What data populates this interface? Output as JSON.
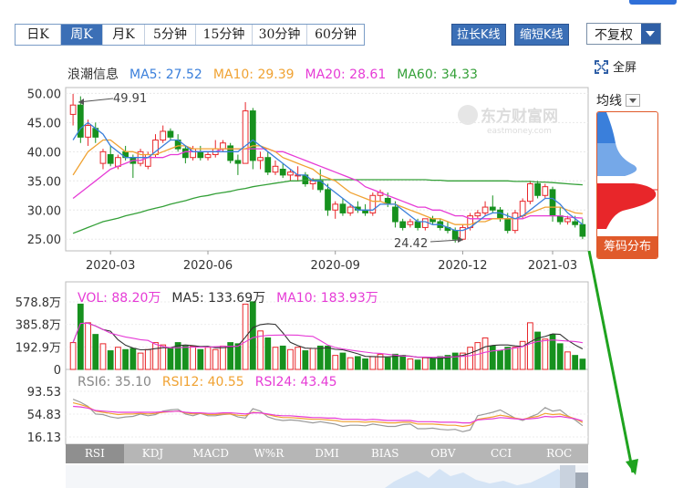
{
  "period_tabs": [
    "日K",
    "周K",
    "月K",
    "5分钟",
    "15分钟",
    "30分钟",
    "60分钟"
  ],
  "active_period": "周K",
  "zoom": {
    "stretch_label": "拉长K线",
    "shrink_label": "缩短K线"
  },
  "adjust": {
    "selected": "不复权"
  },
  "fullscreen_label": "全屏",
  "main_legend": {
    "stock_name": "浪潮信息",
    "ma5": "MA5: 27.52",
    "ma10": "MA10: 29.39",
    "ma20": "MA20: 28.61",
    "ma60": "MA60: 34.33"
  },
  "ma_selector_label": "均线",
  "chip_distribution_label": "筹码分布",
  "watermark": {
    "brand": "东方财富网",
    "domain": "eastmoney.com"
  },
  "high_label": "49.91",
  "low_label": "24.42",
  "price_axis": [
    "50.00",
    "45.00",
    "40.00",
    "35.00",
    "30.00",
    "25.00"
  ],
  "date_axis": [
    "2020-03",
    "2020-06",
    "2020-09",
    "2020-12",
    "2021-03"
  ],
  "volume_legend": {
    "vol": "VOL: 88.20万",
    "ma5": "MA5: 133.69万",
    "ma10": "MA10: 183.93万"
  },
  "volume_axis": [
    "578.8万",
    "385.8万",
    "192.9万",
    "0"
  ],
  "rsi_legend": {
    "rsi6": "RSI6: 35.10",
    "rsi12": "RSI12: 40.55",
    "rsi24": "RSI24: 43.45"
  },
  "rsi_axis": [
    "93.53",
    "54.83",
    "16.13"
  ],
  "indicator_tabs": [
    "RSI",
    "KDJ",
    "MACD",
    "W%R",
    "DMI",
    "BIAS",
    "OBV",
    "CCI",
    "ROC"
  ],
  "active_indicator": "RSI",
  "colors": {
    "up": "#e8262a",
    "down": "#17911e",
    "ma5": "#3a7fdb",
    "ma10": "#f0a232",
    "ma20": "#e63bd6",
    "ma60": "#34a038",
    "accent": "#3b6fb6",
    "chip_orange": "#e05a2b",
    "annotation_arrow": "#1fa31f"
  },
  "chart_data": {
    "type": "candlestick",
    "timeframe": "weekly",
    "ylim": [
      23,
      51
    ],
    "candles": [
      {
        "o": 46.4,
        "h": 49.91,
        "l": 44.5,
        "c": 48.0
      },
      {
        "o": 48.0,
        "h": 49.5,
        "l": 41.5,
        "c": 42.5
      },
      {
        "o": 42.5,
        "h": 45.5,
        "l": 41.0,
        "c": 44.5
      },
      {
        "o": 44.0,
        "h": 45.0,
        "l": 41.5,
        "c": 42.5
      },
      {
        "o": 38.0,
        "h": 40.5,
        "l": 37.0,
        "c": 40.0
      },
      {
        "o": 39.5,
        "h": 41.0,
        "l": 37.5,
        "c": 38.0
      },
      {
        "o": 37.5,
        "h": 39.5,
        "l": 37.0,
        "c": 39.0
      },
      {
        "o": 40.0,
        "h": 41.0,
        "l": 38.5,
        "c": 39.0
      },
      {
        "o": 39.0,
        "h": 39.5,
        "l": 35.5,
        "c": 38.0
      },
      {
        "o": 38.0,
        "h": 40.5,
        "l": 37.5,
        "c": 40.0
      },
      {
        "o": 37.5,
        "h": 40.0,
        "l": 37.0,
        "c": 39.5
      },
      {
        "o": 39.5,
        "h": 43.0,
        "l": 39.0,
        "c": 42.0
      },
      {
        "o": 42.0,
        "h": 44.5,
        "l": 41.5,
        "c": 43.5
      },
      {
        "o": 43.5,
        "h": 44.0,
        "l": 42.0,
        "c": 42.5
      },
      {
        "o": 42.0,
        "h": 43.0,
        "l": 40.0,
        "c": 40.5
      },
      {
        "o": 40.5,
        "h": 41.0,
        "l": 38.0,
        "c": 39.0
      },
      {
        "o": 39.0,
        "h": 41.0,
        "l": 38.5,
        "c": 40.5
      },
      {
        "o": 40.0,
        "h": 41.0,
        "l": 38.5,
        "c": 39.0
      },
      {
        "o": 39.0,
        "h": 40.0,
        "l": 38.5,
        "c": 39.5
      },
      {
        "o": 39.5,
        "h": 42.0,
        "l": 39.0,
        "c": 40.5
      },
      {
        "o": 40.5,
        "h": 42.0,
        "l": 40.0,
        "c": 41.5
      },
      {
        "o": 41.0,
        "h": 41.5,
        "l": 38.0,
        "c": 38.5
      },
      {
        "o": 38.5,
        "h": 39.5,
        "l": 36.0,
        "c": 38.0
      },
      {
        "o": 38.0,
        "h": 48.5,
        "l": 38.0,
        "c": 47.0
      },
      {
        "o": 47.0,
        "h": 47.5,
        "l": 37.0,
        "c": 38.5
      },
      {
        "o": 38.5,
        "h": 40.0,
        "l": 37.0,
        "c": 39.0
      },
      {
        "o": 39.0,
        "h": 40.0,
        "l": 36.0,
        "c": 36.5
      },
      {
        "o": 36.5,
        "h": 38.5,
        "l": 36.0,
        "c": 37.5
      },
      {
        "o": 37.0,
        "h": 38.0,
        "l": 35.5,
        "c": 36.0
      },
      {
        "o": 36.0,
        "h": 37.0,
        "l": 35.0,
        "c": 36.5
      },
      {
        "o": 36.0,
        "h": 37.5,
        "l": 35.0,
        "c": 36.0
      },
      {
        "o": 36.0,
        "h": 36.5,
        "l": 34.0,
        "c": 34.5
      },
      {
        "o": 34.5,
        "h": 35.5,
        "l": 33.5,
        "c": 35.0
      },
      {
        "o": 35.0,
        "h": 37.0,
        "l": 33.0,
        "c": 33.5
      },
      {
        "o": 33.5,
        "h": 34.5,
        "l": 29.0,
        "c": 30.0
      },
      {
        "o": 30.0,
        "h": 31.5,
        "l": 28.5,
        "c": 31.0
      },
      {
        "o": 31.0,
        "h": 32.0,
        "l": 29.0,
        "c": 29.5
      },
      {
        "o": 29.5,
        "h": 31.0,
        "l": 29.0,
        "c": 30.5
      },
      {
        "o": 30.5,
        "h": 31.5,
        "l": 29.5,
        "c": 30.0
      },
      {
        "o": 30.0,
        "h": 31.0,
        "l": 29.0,
        "c": 29.5
      },
      {
        "o": 29.5,
        "h": 33.0,
        "l": 29.0,
        "c": 32.5
      },
      {
        "o": 32.5,
        "h": 33.5,
        "l": 31.5,
        "c": 33.0
      },
      {
        "o": 32.0,
        "h": 33.0,
        "l": 30.5,
        "c": 31.0
      },
      {
        "o": 30.5,
        "h": 31.5,
        "l": 27.0,
        "c": 28.0
      },
      {
        "o": 28.0,
        "h": 28.5,
        "l": 26.5,
        "c": 27.0
      },
      {
        "o": 27.5,
        "h": 28.5,
        "l": 27.0,
        "c": 28.0
      },
      {
        "o": 28.0,
        "h": 28.5,
        "l": 26.5,
        "c": 27.0
      },
      {
        "o": 27.0,
        "h": 28.5,
        "l": 26.5,
        "c": 28.5
      },
      {
        "o": 28.5,
        "h": 29.0,
        "l": 27.5,
        "c": 28.0
      },
      {
        "o": 28.0,
        "h": 28.5,
        "l": 26.5,
        "c": 27.0
      },
      {
        "o": 27.0,
        "h": 28.0,
        "l": 26.0,
        "c": 26.5
      },
      {
        "o": 26.5,
        "h": 27.0,
        "l": 24.42,
        "c": 25.0
      },
      {
        "o": 25.0,
        "h": 27.5,
        "l": 24.8,
        "c": 27.0
      },
      {
        "o": 27.0,
        "h": 29.5,
        "l": 26.5,
        "c": 29.0
      },
      {
        "o": 29.0,
        "h": 30.0,
        "l": 28.5,
        "c": 29.5
      },
      {
        "o": 29.5,
        "h": 31.5,
        "l": 29.0,
        "c": 30.5
      },
      {
        "o": 30.5,
        "h": 32.5,
        "l": 29.5,
        "c": 30.0
      },
      {
        "o": 30.0,
        "h": 30.5,
        "l": 28.0,
        "c": 28.5
      },
      {
        "o": 28.5,
        "h": 29.5,
        "l": 26.0,
        "c": 26.5
      },
      {
        "o": 26.5,
        "h": 30.0,
        "l": 26.0,
        "c": 29.5
      },
      {
        "o": 29.0,
        "h": 32.0,
        "l": 28.5,
        "c": 31.5
      },
      {
        "o": 31.5,
        "h": 35.0,
        "l": 31.0,
        "c": 34.5
      },
      {
        "o": 34.5,
        "h": 35.0,
        "l": 32.0,
        "c": 32.5
      },
      {
        "o": 32.5,
        "h": 34.5,
        "l": 32.0,
        "c": 34.0
      },
      {
        "o": 33.5,
        "h": 34.0,
        "l": 28.0,
        "c": 29.0
      },
      {
        "o": 29.0,
        "h": 30.5,
        "l": 27.5,
        "c": 28.0
      },
      {
        "o": 28.0,
        "h": 29.0,
        "l": 27.5,
        "c": 28.5
      },
      {
        "o": 28.0,
        "h": 29.0,
        "l": 27.0,
        "c": 27.5
      },
      {
        "o": 27.5,
        "h": 28.5,
        "l": 25.0,
        "c": 25.5
      }
    ],
    "ma5": [
      42,
      44,
      45,
      44,
      43,
      41,
      40,
      39,
      39,
      39,
      39,
      40,
      41,
      42,
      42,
      41,
      40,
      40,
      40,
      40,
      40,
      40,
      40,
      41,
      42,
      41,
      40,
      39,
      38,
      37,
      36,
      36,
      35,
      35,
      34,
      33,
      32,
      31,
      30,
      30,
      30,
      31,
      31,
      31,
      30,
      29,
      28,
      28,
      27.5,
      27.5,
      27,
      26.5,
      26.5,
      27,
      28,
      29,
      29.5,
      29.5,
      29,
      28.5,
      29,
      30,
      31,
      32,
      32,
      31,
      29.5,
      28.5,
      27.52
    ],
    "ma10": [
      36,
      38,
      40,
      41,
      42,
      42,
      41,
      40,
      40,
      39.5,
      39.5,
      39.5,
      40,
      40.5,
      41,
      41,
      40.5,
      40.5,
      40.5,
      40.5,
      40.5,
      40.5,
      40.5,
      40.5,
      41,
      41,
      40.5,
      40,
      39,
      38.5,
      38,
      37.5,
      37,
      36,
      35.5,
      35,
      34,
      33,
      32.5,
      32,
      31.5,
      31.5,
      31,
      31,
      30.5,
      30,
      29.5,
      29,
      28.5,
      28.5,
      28,
      27.5,
      27.5,
      27.5,
      28,
      28,
      28.5,
      28.5,
      28.5,
      28.5,
      29,
      29.5,
      30,
      30.5,
      30.5,
      30.5,
      30,
      29.5,
      29.39
    ],
    "ma20": [
      32,
      33,
      34,
      35,
      36,
      37,
      37.5,
      38,
      38.5,
      38.5,
      39,
      39,
      39,
      39.5,
      39.5,
      40,
      40,
      40,
      40,
      40,
      40.5,
      40.5,
      40.5,
      40.5,
      40.5,
      40.5,
      40.5,
      40,
      40,
      39.5,
      39,
      38.5,
      38,
      37.5,
      37,
      36.5,
      36,
      35.5,
      35,
      34,
      33.5,
      33,
      32.5,
      32,
      31.5,
      31,
      30.5,
      30.5,
      30,
      30,
      29.5,
      29,
      29,
      28.5,
      28.5,
      28.5,
      28.5,
      28.5,
      28.5,
      28.5,
      28.5,
      29,
      29,
      29,
      29,
      29,
      28.8,
      28.7,
      28.61
    ],
    "ma60": [
      26,
      26.5,
      27,
      27.5,
      28,
      28.3,
      28.6,
      29,
      29.3,
      29.6,
      30,
      30.3,
      30.6,
      31,
      31.3,
      31.6,
      32,
      32.3,
      32.5,
      32.8,
      33,
      33.2,
      33.5,
      33.7,
      34,
      34.2,
      34.4,
      34.6,
      34.8,
      35,
      35,
      35.1,
      35.2,
      35.2,
      35.2,
      35.2,
      35.2,
      35.2,
      35.2,
      35.2,
      35.2,
      35.2,
      35.2,
      35.2,
      35.2,
      35.2,
      35.2,
      35.2,
      35.1,
      35.1,
      35,
      35,
      35,
      35,
      35,
      35,
      35,
      35,
      35,
      34.9,
      34.9,
      34.9,
      34.8,
      34.8,
      34.7,
      34.6,
      34.5,
      34.4,
      34.33
    ],
    "volume_max": 578.8,
    "volume_wan": [
      230,
      560,
      400,
      300,
      220,
      160,
      190,
      170,
      180,
      140,
      170,
      230,
      210,
      180,
      230,
      200,
      200,
      170,
      190,
      170,
      200,
      230,
      220,
      560,
      580,
      330,
      270,
      190,
      200,
      170,
      190,
      160,
      180,
      200,
      200,
      120,
      140,
      100,
      110,
      90,
      110,
      130,
      100,
      130,
      120,
      90,
      80,
      100,
      90,
      110,
      120,
      140,
      140,
      190,
      230,
      270,
      200,
      160,
      190,
      190,
      240,
      400,
      320,
      260,
      300,
      220,
      150,
      120,
      88.2
    ],
    "rsi_ylim": [
      16.13,
      93.53
    ],
    "rsi6": [
      80,
      75,
      68,
      55,
      54,
      50,
      48,
      50,
      51,
      55,
      52,
      54,
      60,
      62,
      63,
      55,
      52,
      56,
      52,
      52,
      54,
      55,
      50,
      48,
      64,
      60,
      50,
      46,
      44,
      45,
      44,
      42,
      40,
      42,
      40,
      38,
      34,
      36,
      36,
      35,
      38,
      36,
      34,
      34,
      37,
      38,
      30,
      30,
      31,
      29,
      28,
      29,
      25,
      28,
      52,
      55,
      58,
      62,
      55,
      48,
      44,
      50,
      55,
      66,
      60,
      62,
      52,
      45,
      35.1
    ],
    "rsi12": [
      74,
      71,
      67,
      60,
      58,
      56,
      54,
      55,
      55,
      56,
      55,
      56,
      58,
      59,
      60,
      57,
      55,
      56,
      54,
      54,
      55,
      55,
      53,
      52,
      58,
      57,
      54,
      51,
      49,
      49,
      48,
      47,
      46,
      46,
      45,
      44,
      42,
      42,
      42,
      41,
      42,
      41,
      40,
      40,
      41,
      41,
      38,
      38,
      38,
      37,
      36,
      36,
      34,
      36,
      46,
      48,
      50,
      53,
      51,
      48,
      46,
      49,
      51,
      56,
      54,
      55,
      51,
      47,
      40.55
    ],
    "rsi24": [
      68,
      67,
      65,
      61,
      60,
      59,
      58,
      58,
      58,
      58,
      58,
      58,
      59,
      59,
      60,
      58,
      57,
      57,
      56,
      56,
      57,
      57,
      56,
      55,
      57,
      57,
      55,
      53,
      52,
      52,
      51,
      50,
      49,
      49,
      48,
      48,
      46,
      46,
      46,
      45,
      46,
      45,
      44,
      44,
      44,
      44,
      42,
      42,
      42,
      41,
      41,
      41,
      40,
      40,
      45,
      46,
      47,
      49,
      48,
      47,
      46,
      47,
      48,
      51,
      50,
      51,
      49,
      47,
      43.45
    ]
  }
}
